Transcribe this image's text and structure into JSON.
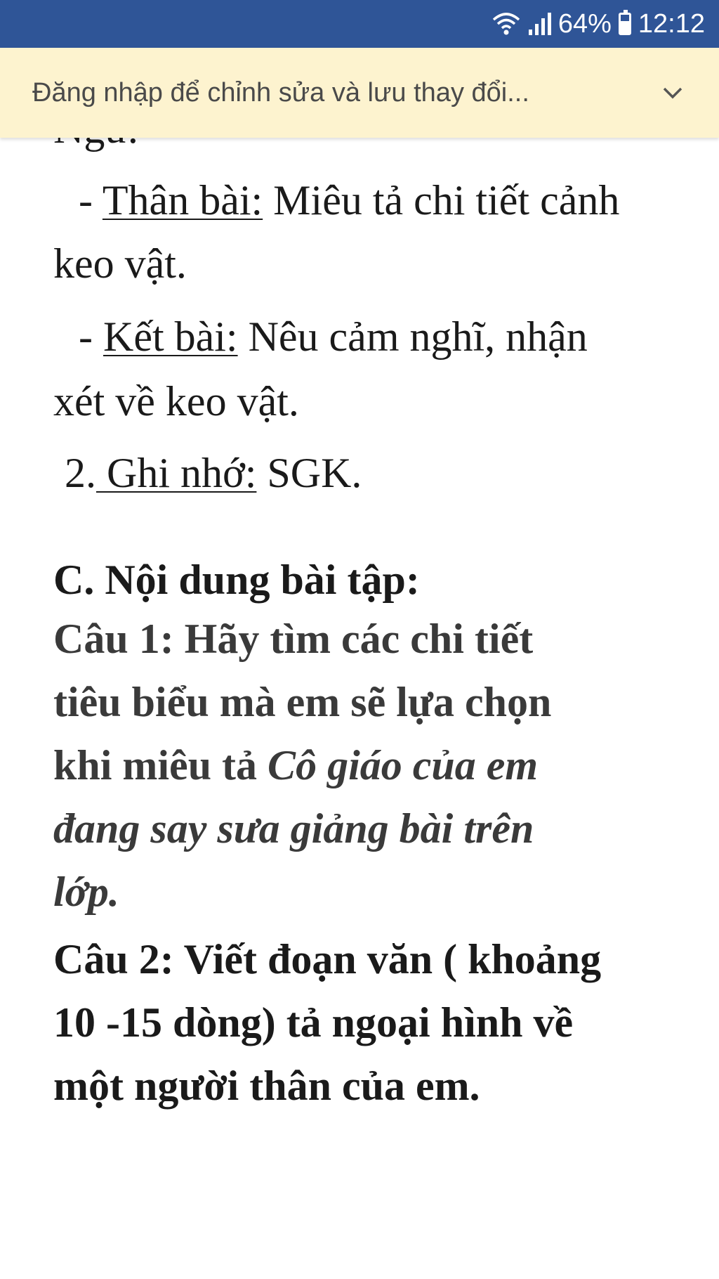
{
  "status_bar": {
    "battery": "64%",
    "battery_level": 0.64,
    "time": "12:12",
    "icons": [
      "wifi-icon",
      "signal-icon",
      "battery-icon"
    ]
  },
  "banner": {
    "text": "Đăng nhập để chỉnh sửa và lưu thay đổi...",
    "icon": "chevron-down-icon"
  },
  "document": {
    "cut_top": "Ngữ.",
    "l1_dash": "- ",
    "l1_label": "Thân bài:",
    "l1_text": " Miêu tả chi tiết cảnh",
    "l2": "keo vật.",
    "l3_dash": "- ",
    "l3_label": "Kết bài:",
    "l3_text": "  Nêu cảm nghĩ, nhận",
    "l4": "xét về keo vật.",
    "l5_num": "2.",
    "l5_label": " Ghi nhớ:",
    "l5_text": " SGK.",
    "heading": "C. Nội dung bài tập:",
    "q1_l1": "Câu 1:  Hãy tìm các chi tiết",
    "q1_l2": "tiêu biểu mà em sẽ lựa chọn",
    "q1_l3a": "khi miêu tả ",
    "q1_l3b": "Cô giáo của em",
    "q1_l4": "đang say sưa giảng bài trên",
    "q1_l5": "lớp.",
    "q2_l1": "Câu 2: Viết đoạn văn ( khoảng",
    "q2_l2": "10 -15 dòng) tả ngoại hình về",
    "q2_l3": "một người thân của em."
  },
  "colors": {
    "status_bar": "#2f5597",
    "banner_bg": "#fdf3cf",
    "text": "#1a1a1a"
  }
}
